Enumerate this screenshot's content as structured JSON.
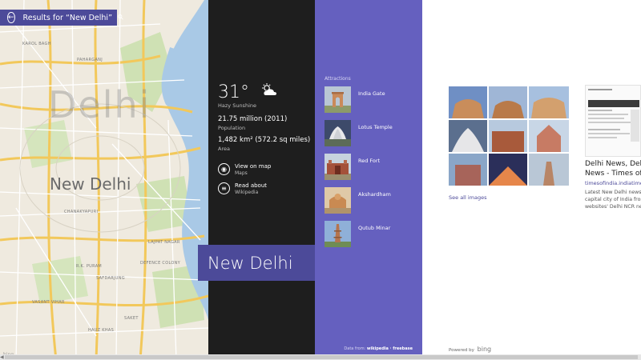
{
  "search": {
    "query_label": "Results for “New Delhi”"
  },
  "map": {
    "big_label": "Delhi",
    "city_label": "New Delhi",
    "labels": [
      "KAROL BAGH",
      "PAHARGANJ",
      "CHANAKYAPURI",
      "LAJPAT NAGAR",
      "DEFENCE COLONY",
      "SAFDARJUNG",
      "SAKET",
      "R.K. PURAM",
      "VASANT VIHAR",
      "HAUZ KHAS"
    ],
    "attribution": "bing"
  },
  "title_tile": {
    "name": "New Delhi"
  },
  "info": {
    "temperature": "31°",
    "weather": "Hazy Sunshine",
    "population_value": "21.75 million (2011)",
    "population_label": "Population",
    "area_value": "1,482 km² (572.2 sq miles)",
    "area_label": "Area",
    "links": [
      {
        "title": "View on map",
        "subtitle": "Maps"
      },
      {
        "title": "Read about",
        "subtitle": "Wikipedia"
      }
    ]
  },
  "attractions": {
    "heading": "Attractions",
    "items": [
      {
        "name": "India Gate"
      },
      {
        "name": "Lotus Temple"
      },
      {
        "name": "Red Fort"
      },
      {
        "name": "Akshardham"
      },
      {
        "name": "Qutub Minar"
      }
    ],
    "data_from_prefix": "Data from:",
    "data_from_sources": "wikipedia · freebase"
  },
  "images": {
    "see_all": "See all images"
  },
  "news": {
    "title_line1": "Delhi News, Delhi",
    "title_line2": "News - Times of In",
    "url": "timesofindia.indiatimes.com",
    "snippet_lines": [
      "Latest New Delhi news sto",
      "capital city of India from t",
      "websites' Delhi NCR news"
    ]
  },
  "footer": {
    "powered_by": "Powered by",
    "brand": "bing"
  },
  "colors": {
    "accent": "#4c4a99",
    "attractions_bg": "#6560bf",
    "info_bg": "#1e1e1e"
  }
}
